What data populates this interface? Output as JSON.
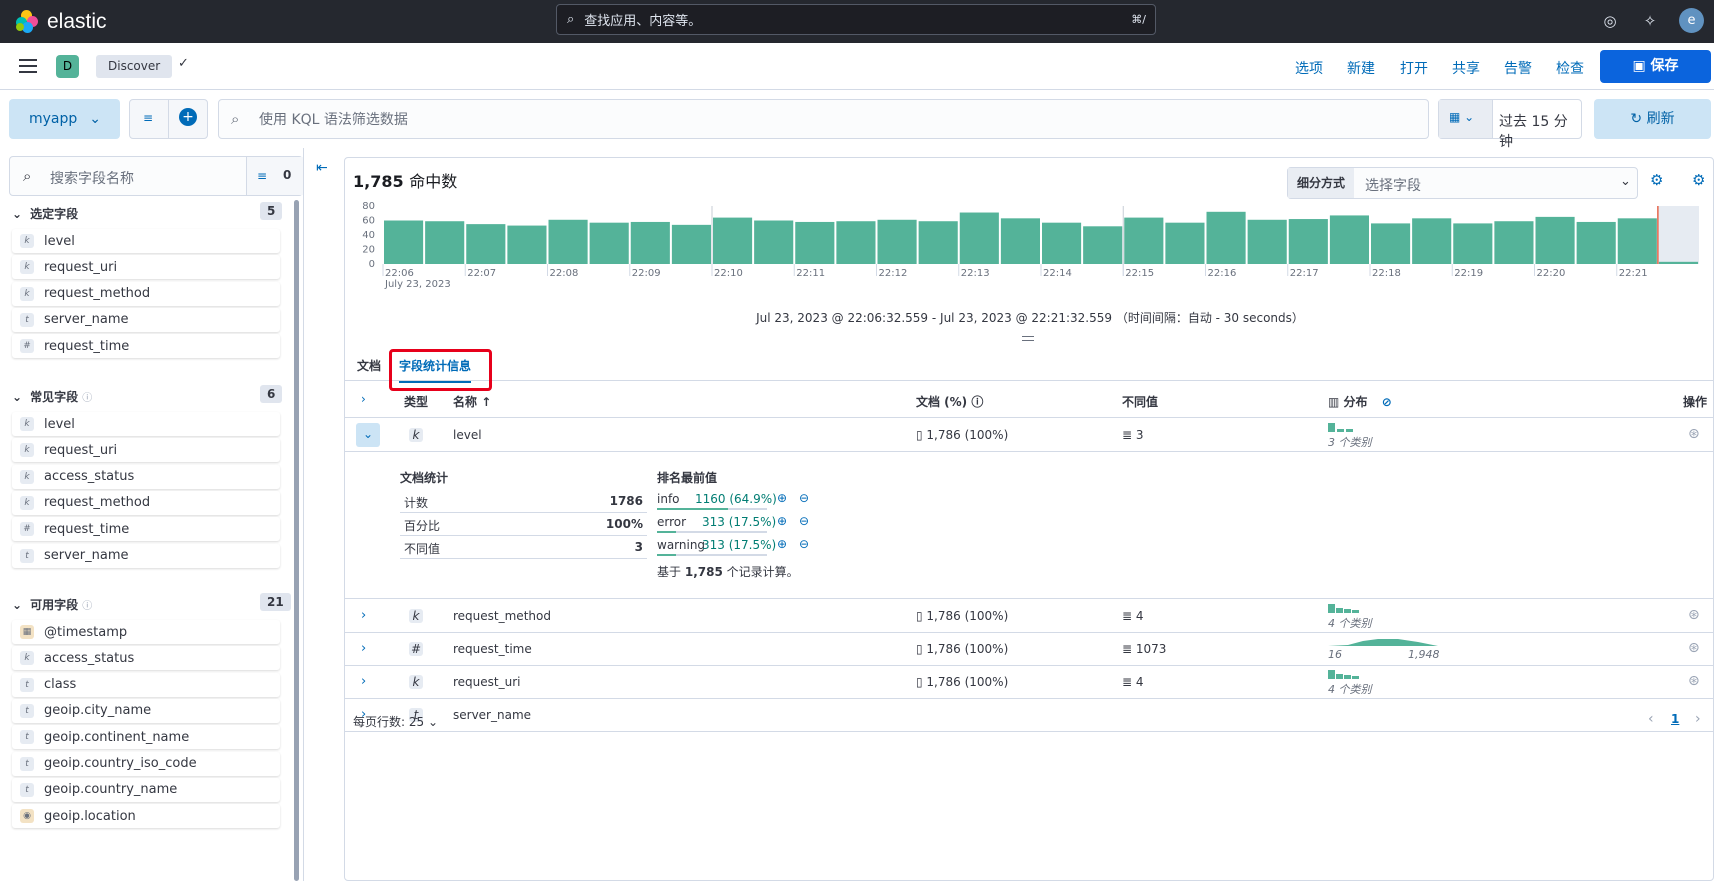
{
  "topbar": {
    "brand": "elastic",
    "search_placeholder": "查找应用、内容等。",
    "search_shortcut": "⌘/",
    "avatar": "e"
  },
  "appbar": {
    "space_badge": "D",
    "breadcrumb": "Discover",
    "actions": [
      "选项",
      "新建",
      "打开",
      "共享",
      "告警",
      "检查"
    ],
    "save": "保存"
  },
  "querybar": {
    "data_view": "myapp",
    "kql_placeholder": "使用 KQL 语法筛选数据",
    "time": "过去 15 分钟",
    "refresh": "刷新"
  },
  "sidebar": {
    "search_placeholder": "搜索字段名称",
    "filter_count": "0",
    "sections": [
      {
        "title": "选定字段",
        "count": "5",
        "fields": [
          {
            "type": "k",
            "name": "level"
          },
          {
            "type": "k",
            "name": "request_uri"
          },
          {
            "type": "k",
            "name": "request_method"
          },
          {
            "type": "t",
            "name": "server_name"
          },
          {
            "type": "#",
            "name": "request_time"
          }
        ]
      },
      {
        "title": "常见字段",
        "count": "6",
        "fields": [
          {
            "type": "k",
            "name": "level"
          },
          {
            "type": "k",
            "name": "request_uri"
          },
          {
            "type": "k",
            "name": "access_status"
          },
          {
            "type": "k",
            "name": "request_method"
          },
          {
            "type": "#",
            "name": "request_time"
          },
          {
            "type": "t",
            "name": "server_name"
          }
        ]
      },
      {
        "title": "可用字段",
        "count": "21",
        "fields": [
          {
            "type": "cal",
            "name": "@timestamp"
          },
          {
            "type": "k",
            "name": "access_status"
          },
          {
            "type": "t",
            "name": "class"
          },
          {
            "type": "t",
            "name": "geoip.city_name"
          },
          {
            "type": "t",
            "name": "geoip.continent_name"
          },
          {
            "type": "t",
            "name": "geoip.country_iso_code"
          },
          {
            "type": "t",
            "name": "geoip.country_name"
          },
          {
            "type": "geo",
            "name": "geoip.location"
          }
        ]
      }
    ]
  },
  "main": {
    "hits": "1,785",
    "hits_unit": "命中数",
    "breakdown_label": "细分方式",
    "breakdown_placeholder": "选择字段",
    "time_range": "Jul 23, 2023 @ 22:06:32.559 - Jul 23, 2023 @ 22:21:32.559  （时间间隔：自动 - 30 seconds）",
    "tabs": [
      "文档",
      "字段统计信息"
    ],
    "columns": {
      "type": "类型",
      "name": "名称",
      "docs": "文档 (%)",
      "distinct": "不同值",
      "dist": "分布",
      "actions": "操作"
    },
    "rows": [
      {
        "type": "k",
        "name": "level",
        "docs": "1,786 (100%)",
        "distinct": "3",
        "dist": "3 个类别"
      },
      {
        "type": "k",
        "name": "request_method",
        "docs": "1,786 (100%)",
        "distinct": "4",
        "dist": "4 个类别"
      },
      {
        "type": "#",
        "name": "request_time",
        "docs": "1,786 (100%)",
        "distinct": "1073",
        "dist_min": "16",
        "dist_max": "1,948"
      },
      {
        "type": "k",
        "name": "request_uri",
        "docs": "1,786 (100%)",
        "distinct": "4",
        "dist": "4 个类别"
      },
      {
        "type": "t",
        "name": "server_name"
      }
    ],
    "expanded": {
      "doc_stats_title": "文档统计",
      "top_values_title": "排名最前值",
      "stats": [
        {
          "label": "计数",
          "value": "1786"
        },
        {
          "label": "百分比",
          "value": "100%"
        },
        {
          "label": "不同值",
          "value": "3"
        }
      ],
      "top_values": [
        {
          "label": "info",
          "value": "1160 (64.9%)",
          "pct": 0.649
        },
        {
          "label": "error",
          "value": "313 (17.5%)",
          "pct": 0.175
        },
        {
          "label": "warning",
          "value": "313 (17.5%)",
          "pct": 0.175
        }
      ],
      "footnote_pre": "基于",
      "footnote_num": "1,785",
      "footnote_post": "个记录计算。"
    },
    "pager": {
      "rows_per_page": "每页行数: 25",
      "page": "1"
    }
  },
  "chart_data": {
    "type": "bar",
    "categories": [
      "22:06",
      "22:06:30",
      "22:07",
      "22:07:30",
      "22:08",
      "22:08:30",
      "22:09",
      "22:09:30",
      "22:10",
      "22:10:30",
      "22:11",
      "22:11:30",
      "22:12",
      "22:12:30",
      "22:13",
      "22:13:30",
      "22:14",
      "22:14:30",
      "22:15",
      "22:15:30",
      "22:16",
      "22:16:30",
      "22:17",
      "22:17:30",
      "22:18",
      "22:18:30",
      "22:19",
      "22:19:30",
      "22:20",
      "22:20:30",
      "22:21",
      "22:21:30"
    ],
    "values": [
      60,
      59,
      55,
      53,
      61,
      57,
      58,
      54,
      64,
      60,
      58,
      59,
      61,
      59,
      71,
      63,
      57,
      52,
      64,
      57,
      72,
      61,
      62,
      67,
      56,
      63,
      56,
      59,
      65,
      58,
      63,
      3
    ],
    "yticks": [
      "80",
      "60",
      "40",
      "20",
      "0"
    ],
    "xticks": [
      "22:06",
      "22:07",
      "22:08",
      "22:09",
      "22:10",
      "22:11",
      "22:12",
      "22:13",
      "22:14",
      "22:15",
      "22:16",
      "22:17",
      "22:18",
      "22:19",
      "22:20",
      "22:21"
    ],
    "date_label": "July 23, 2023",
    "ylim": [
      0,
      80
    ],
    "color": "#54b399"
  }
}
